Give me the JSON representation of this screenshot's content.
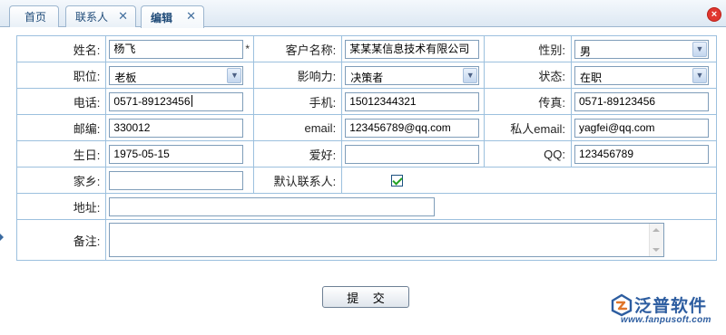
{
  "tabs": [
    {
      "label": "首页",
      "closable": false,
      "active": false
    },
    {
      "label": "联系人",
      "closable": true,
      "active": false
    },
    {
      "label": "编辑",
      "closable": true,
      "active": true
    }
  ],
  "close_all_glyph": "×",
  "form": {
    "name": {
      "label": "姓名:",
      "value": "杨飞",
      "required_mark": "*"
    },
    "customer": {
      "label": "客户名称:",
      "value": "某某某信息技术有限公司"
    },
    "gender": {
      "label": "性别:",
      "value": "男"
    },
    "position": {
      "label": "职位:",
      "value": "老板"
    },
    "influence": {
      "label": "影响力:",
      "value": "决策者"
    },
    "status": {
      "label": "状态:",
      "value": "在职"
    },
    "phone": {
      "label": "电话:",
      "value": "0571-89123456"
    },
    "mobile": {
      "label": "手机:",
      "value": "15012344321"
    },
    "fax": {
      "label": "传真:",
      "value": "0571-89123456"
    },
    "postcode": {
      "label": "邮编:",
      "value": "330012"
    },
    "email": {
      "label": "email:",
      "value": "123456789@qq.com"
    },
    "private_email": {
      "label": "私人email:",
      "value": "yagfei@qq.com"
    },
    "birthday": {
      "label": "生日:",
      "value": "1975-05-15"
    },
    "hobby": {
      "label": "爱好:",
      "value": ""
    },
    "qq": {
      "label": "QQ:",
      "value": "123456789"
    },
    "hometown": {
      "label": "家乡:",
      "value": ""
    },
    "default_contact": {
      "label": "默认联系人:",
      "checked": true
    },
    "address": {
      "label": "地址:",
      "value": ""
    },
    "notes": {
      "label": "备注:",
      "value": ""
    }
  },
  "submit_label": "提 交",
  "logo": {
    "name": "泛普软件",
    "url": "www.fanpusoft.com",
    "icon": "fanpu-logo-icon"
  },
  "colors": {
    "border": "#9cc0de",
    "tab_text": "#1e4a78",
    "brand": "#2d5da0",
    "close": "#e0362f"
  }
}
